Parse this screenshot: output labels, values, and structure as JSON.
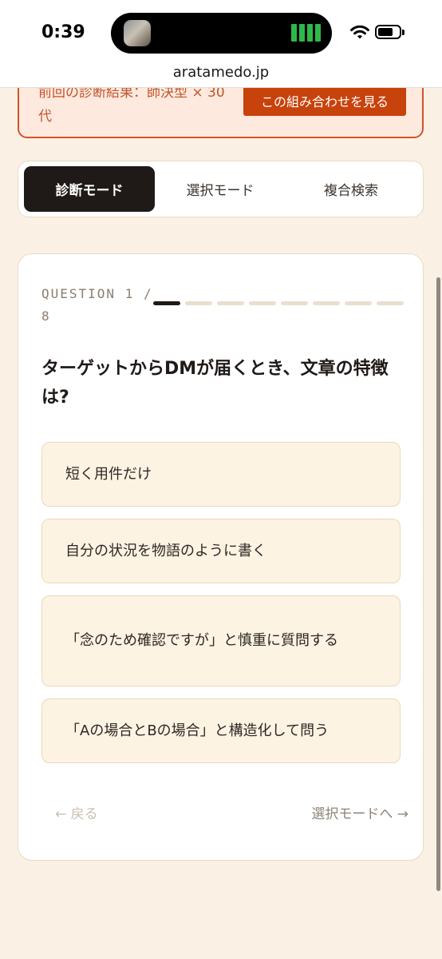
{
  "status_bar": {
    "time": "0:39",
    "battery_level": 0.7
  },
  "browser": {
    "url": "aratamedo.jp"
  },
  "banner": {
    "text": "前回の診断結果：師決型 × 30代",
    "button_label": "この組み合わせを見る"
  },
  "mode_tabs": [
    {
      "label": "診断モード",
      "active": true
    },
    {
      "label": "選択モード",
      "active": false
    },
    {
      "label": "複合検索",
      "active": false
    }
  ],
  "question": {
    "label": "QUESTION 1 / 8",
    "current": 1,
    "total": 8,
    "text": "ターゲットからDMが届くとき、文章の特徴は?",
    "options": [
      "短く用件だけ",
      "自分の状況を物語のように書く",
      "「念のため確認ですが」と慎重に質問する",
      "「Aの場合とBの場合」と構造化して問う"
    ]
  },
  "nav": {
    "back": "← 戻る",
    "next": "選択モードへ →"
  },
  "colors": {
    "accent": "#c8420c",
    "active_tab": "#1f1a17",
    "background": "#faf1e4"
  }
}
